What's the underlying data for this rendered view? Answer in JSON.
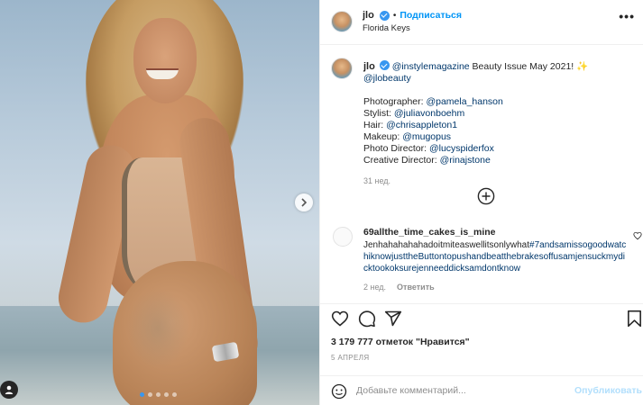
{
  "header": {
    "username": "jlo",
    "follow_label": "Подписаться",
    "location": "Florida Keys",
    "more_label": "•••"
  },
  "caption": {
    "username": "jlo",
    "mention_main": "@instylemagazine",
    "text": " Beauty Issue May 2021! ",
    "emoji": "✨",
    "mention_beauty": "@jlobeauty",
    "credits": [
      {
        "role": "Photographer: ",
        "handle": "@pamela_hanson"
      },
      {
        "role": "Stylist: ",
        "handle": "@juliavonboehm"
      },
      {
        "role": "Hair: ",
        "handle": "@chrisappleton1"
      },
      {
        "role": "Makeup: ",
        "handle": "@mugopus"
      },
      {
        "role": "Photo Director: ",
        "handle": "@lucyspiderfox"
      },
      {
        "role": "Creative Director: ",
        "handle": "@rinajstone"
      }
    ],
    "time_ago": "31 нед."
  },
  "comment": {
    "username": "69allthe_time_cakes_is_mine",
    "text_plain": "Jenhahahahahadoitmiteaswellitsonlywhat",
    "hashtag": "#7andsamissogoodwatchiknowjusttheButtontopushandbeatthebrakesoffusamjensuckmydicktookoksurejenneeddicksamdontknow",
    "time_ago": "2 нед.",
    "reply_label": "Ответить"
  },
  "likes_text": "3 179 777 отметок \"Нравится\"",
  "post_date": "5 АПРЕЛЯ",
  "add_comment": {
    "placeholder": "Добавьте комментарий...",
    "publish_label": "Опубликовать"
  },
  "carousel": {
    "slides": 5,
    "active": 1
  },
  "colors": {
    "link": "#00376b",
    "accent": "#0095f6",
    "muted": "#8e8e8e",
    "publish_disabled": "#b2dffc"
  },
  "icons": [
    "chevron-right-icon",
    "user-tag-icon",
    "verified-icon",
    "more-icon",
    "plus-circle-icon",
    "heart-icon",
    "comment-icon",
    "share-icon",
    "bookmark-icon",
    "emoji-icon"
  ]
}
